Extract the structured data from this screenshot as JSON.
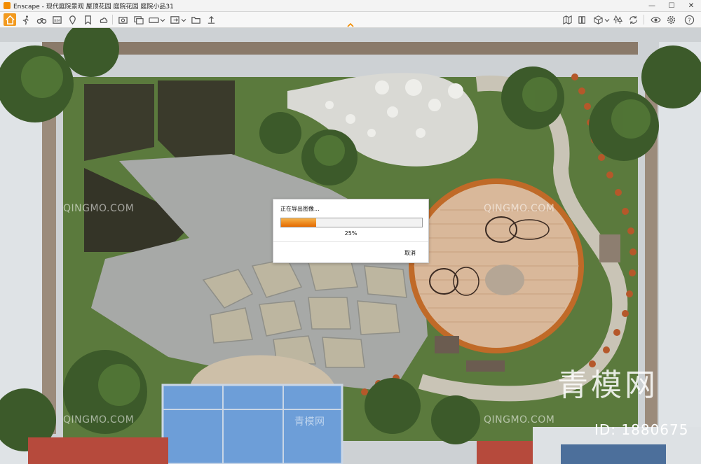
{
  "window": {
    "app_name": "Enscape",
    "title": "Enscape - 现代庭院景观 屋顶花园 庭院花园 庭院小品31",
    "minimize": "—",
    "maximize": "☐",
    "close": "✕"
  },
  "toolbar": {
    "accent": "#f29a1f",
    "left_icons": [
      "home-icon",
      "walk-icon",
      "binoculars-icon",
      "bim-icon",
      "pin-icon",
      "bookmark-icon",
      "screenshot-icon",
      "video-icon",
      "panorama-icon",
      "export-icon",
      "folder-icon",
      "upload-icon"
    ],
    "right_icons": [
      "map-icon",
      "asset-library-icon",
      "cube-icon",
      "grid-icon",
      "trees-icon",
      "sync-icon",
      "visual-settings-icon",
      "settings-icon",
      "help-icon"
    ]
  },
  "dialog": {
    "title": "正在导出图像...",
    "progress": 0.25,
    "percent_label": "25%",
    "cancel_label": "取消",
    "bar_color_start": "#f6b24a",
    "bar_color_end": "#e46a00"
  },
  "watermarks": {
    "site": "QINGMO.COM",
    "brand": "青模网",
    "id": "ID: 1880675"
  }
}
